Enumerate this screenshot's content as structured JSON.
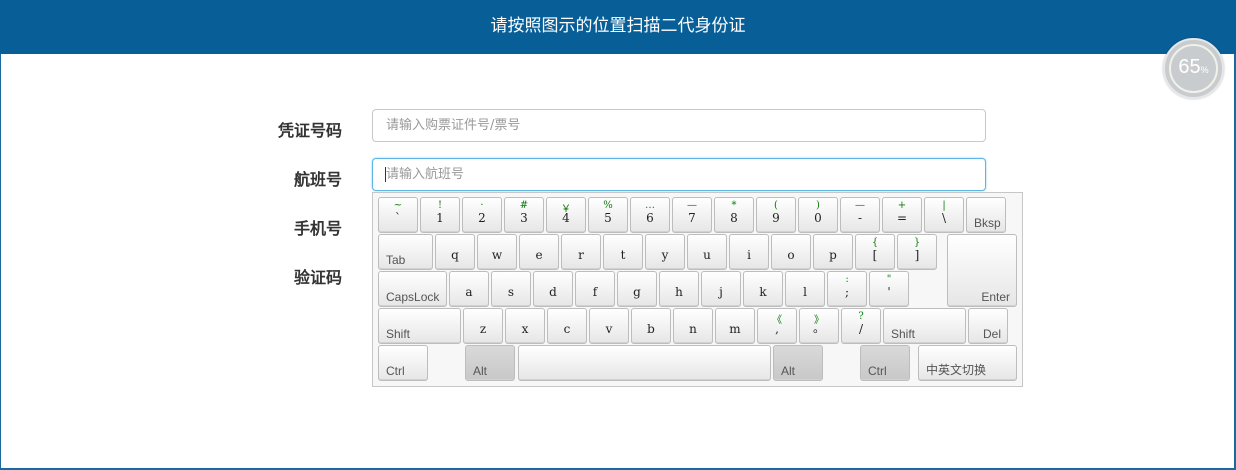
{
  "header": {
    "title": "请按照图示的位置扫描二代身份证"
  },
  "timer": {
    "value": "65",
    "unit": "%"
  },
  "form": {
    "voucher_label": "凭证号码",
    "voucher_placeholder": "请输入购票证件号/票号",
    "flight_label": "航班号",
    "flight_placeholder": "请输入航班号",
    "phone_label": "手机号",
    "code_label": "验证码"
  },
  "keyboard": {
    "row1": [
      {
        "low": "`",
        "up": "~"
      },
      {
        "low": "1",
        "up": "!"
      },
      {
        "low": "2",
        "up": "·"
      },
      {
        "low": "3",
        "up": "#"
      },
      {
        "low": "4",
        "up": "￥"
      },
      {
        "low": "5",
        "up": "%"
      },
      {
        "low": "6",
        "up": "…"
      },
      {
        "low": "7",
        "up": "—"
      },
      {
        "low": "8",
        "up": "*"
      },
      {
        "low": "9",
        "up": "("
      },
      {
        "low": "0",
        "up": ")"
      },
      {
        "low": "-",
        "up": "—"
      },
      {
        "low": "=",
        "up": "+"
      },
      {
        "low": "\\",
        "up": "|"
      }
    ],
    "bksp": "Bksp",
    "tab": "Tab",
    "row2": [
      {
        "low": "q"
      },
      {
        "low": "w"
      },
      {
        "low": "e"
      },
      {
        "low": "r"
      },
      {
        "low": "t"
      },
      {
        "low": "y"
      },
      {
        "low": "u"
      },
      {
        "low": "i"
      },
      {
        "low": "o"
      },
      {
        "low": "p"
      },
      {
        "low": "[",
        "up": "{"
      },
      {
        "low": "]",
        "up": "}"
      }
    ],
    "capslock": "CapsLock",
    "row3": [
      {
        "low": "a"
      },
      {
        "low": "s"
      },
      {
        "low": "d"
      },
      {
        "low": "f"
      },
      {
        "low": "g"
      },
      {
        "low": "h"
      },
      {
        "low": "j"
      },
      {
        "low": "k"
      },
      {
        "low": "l"
      },
      {
        "low": ";",
        "up": ":"
      },
      {
        "low": "'",
        "up": "\""
      }
    ],
    "enter": "Enter",
    "shift_left": "Shift",
    "row4": [
      {
        "low": "z"
      },
      {
        "low": "x"
      },
      {
        "low": "c"
      },
      {
        "low": "v"
      },
      {
        "low": "b"
      },
      {
        "low": "n"
      },
      {
        "low": "m"
      },
      {
        "low": ",",
        "up": "《"
      },
      {
        "low": "。",
        "up": "》"
      },
      {
        "low": "/",
        "up": "?"
      }
    ],
    "shift_right": "Shift",
    "del": "Del",
    "ctrl_left": "Ctrl",
    "alt_left": "Alt",
    "alt_right": "Alt",
    "ctrl_right": "Ctrl",
    "lang_switch": "中英文切换"
  }
}
